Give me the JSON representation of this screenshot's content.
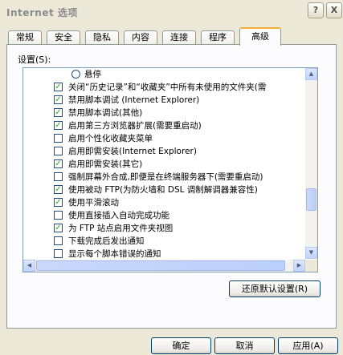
{
  "window": {
    "title": "Internet 选项",
    "help_label": "?",
    "close_label": "X"
  },
  "tabs": [
    {
      "label": "常规"
    },
    {
      "label": "安全"
    },
    {
      "label": "隐私"
    },
    {
      "label": "内容"
    },
    {
      "label": "连接"
    },
    {
      "label": "程序"
    },
    {
      "label": "高级",
      "active": true
    }
  ],
  "settings": {
    "label": "设置(S):",
    "items": [
      {
        "type": "radio",
        "checked": false,
        "label": "悬停"
      },
      {
        "type": "checkbox",
        "checked": true,
        "label": "关闭“历史记录”和“收藏夹”中所有未使用的文件夹(需"
      },
      {
        "type": "checkbox",
        "checked": true,
        "label": "禁用脚本调试 (Internet Explorer)"
      },
      {
        "type": "checkbox",
        "checked": true,
        "label": "禁用脚本调试(其他)"
      },
      {
        "type": "checkbox",
        "checked": true,
        "label": "启用第三方浏览器扩展(需要重启动)"
      },
      {
        "type": "checkbox",
        "checked": false,
        "label": "启用个性化收藏夹菜单"
      },
      {
        "type": "checkbox",
        "checked": false,
        "label": "启用即需安装(Internet Explorer)"
      },
      {
        "type": "checkbox",
        "checked": true,
        "label": "启用即需安装(其它)"
      },
      {
        "type": "checkbox",
        "checked": false,
        "label": "强制屏幕外合成,即便是在终端服务器下(需要重启动)"
      },
      {
        "type": "checkbox",
        "checked": true,
        "label": "使用被动 FTP(为防火墙和 DSL 调制解调器兼容性)"
      },
      {
        "type": "checkbox",
        "checked": true,
        "label": "使用平滑滚动"
      },
      {
        "type": "checkbox",
        "checked": false,
        "label": "使用直接插入自动完成功能"
      },
      {
        "type": "checkbox",
        "checked": true,
        "label": "为 FTP 站点启用文件夹视图"
      },
      {
        "type": "checkbox",
        "checked": false,
        "label": "下载完成后发出通知"
      },
      {
        "type": "checkbox",
        "checked": false,
        "label": "显示每个脚本错误的通知"
      }
    ],
    "vscroll_position": 0.72,
    "hscroll_position": 0.0
  },
  "buttons": {
    "restore_defaults": "还原默认设置(R)",
    "ok": "确定",
    "cancel": "取消",
    "apply": "应用(A)"
  },
  "colors": {
    "dialog_bg": "#ECE9D8",
    "active_tab_accent": "#F5AC3A",
    "check_mark": "#21A121",
    "button_border": "#003C74"
  }
}
